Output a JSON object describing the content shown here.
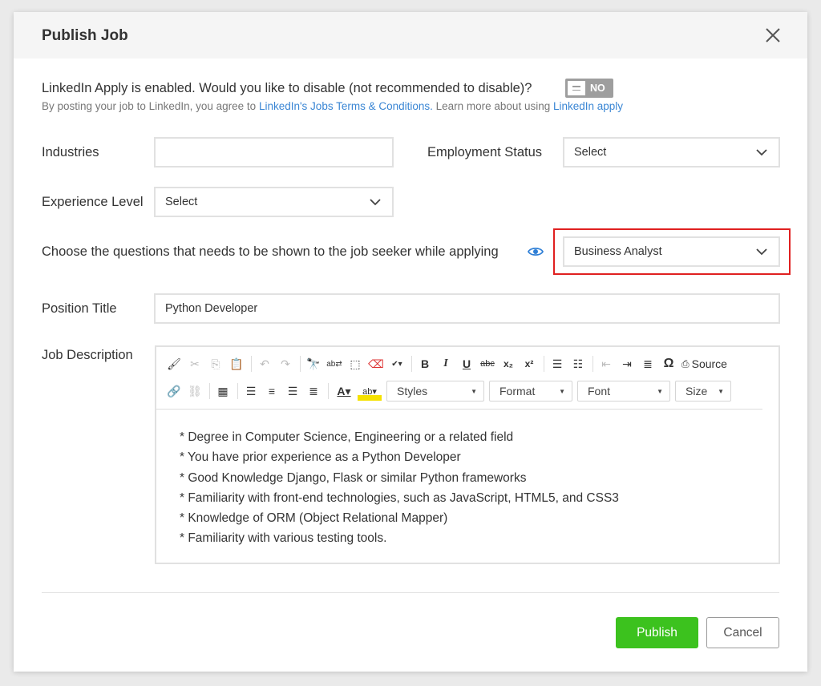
{
  "modal": {
    "title": "Publish Job"
  },
  "linkedin": {
    "question": "LinkedIn Apply is enabled. Would you like to disable (not recommended to disable)?",
    "toggle_label": "NO",
    "sub_prefix": "By posting your job to LinkedIn, you agree to ",
    "terms_link": "LinkedIn's Jobs Terms & Conditions.",
    "sub_middle": " Learn more about using ",
    "apply_link": "LinkedIn apply"
  },
  "form": {
    "industries_label": "Industries",
    "industries_value": "",
    "employment_status_label": "Employment Status",
    "employment_status_value": "Select",
    "experience_level_label": "Experience Level",
    "experience_level_value": "Select",
    "questions_label": "Choose the questions that needs to be shown to the job seeker while applying",
    "questions_value": "Business Analyst",
    "position_title_label": "Position Title",
    "position_title_value": "Python Developer",
    "job_description_label": "Job Description"
  },
  "editor": {
    "source_label": "Source",
    "styles_label": "Styles",
    "format_label": "Format",
    "font_label": "Font",
    "size_label": "Size",
    "bold": "B",
    "italic": "I",
    "underline": "U",
    "strike": "abc",
    "lines": [
      "* Degree in Computer Science, Engineering or a related field",
      "* You have prior experience as a Python Developer",
      "* Good Knowledge Django, Flask or similar Python frameworks",
      "* Familiarity with front-end technologies, such as JavaScript, HTML5, and CSS3",
      "* Knowledge of ORM (Object Relational Mapper)",
      "* Familiarity with various testing tools."
    ]
  },
  "actions": {
    "publish_label": "Publish",
    "cancel_label": "Cancel"
  },
  "colors": {
    "publish_green": "#3cc21e",
    "link_blue": "#3a86d4",
    "highlight_red": "#e02020",
    "toggle_gray": "#9e9e9e"
  }
}
